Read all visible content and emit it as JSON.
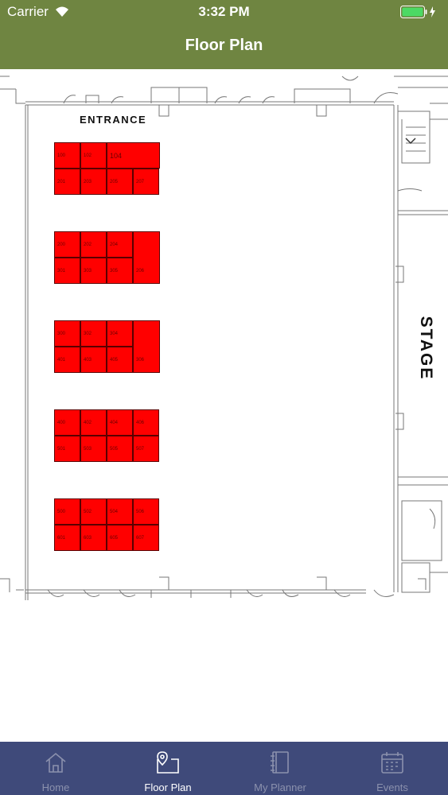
{
  "status": {
    "carrier": "Carrier",
    "time": "3:32 PM"
  },
  "header": {
    "title": "Floor Plan"
  },
  "map": {
    "entrance_label": "ENTRANCE",
    "stage_label": "STAGE",
    "booth_color": "#ff0000",
    "blocks": [
      {
        "top": [
          "100",
          "102",
          "104"
        ],
        "bottom": [
          "201",
          "203",
          "205",
          "207"
        ]
      },
      {
        "top": [
          "200",
          "202",
          "204"
        ],
        "bottom": [
          "301",
          "303",
          "305"
        ],
        "tall": "206"
      },
      {
        "top": [
          "300",
          "302",
          "304"
        ],
        "bottom": [
          "401",
          "403",
          "405"
        ],
        "tall": "306"
      },
      {
        "top": [
          "400",
          "402",
          "404",
          "406"
        ],
        "bottom": [
          "501",
          "503",
          "505",
          "507"
        ]
      },
      {
        "top": [
          "500",
          "502",
          "504",
          "506"
        ],
        "bottom": [
          "601",
          "603",
          "605",
          "607"
        ]
      }
    ]
  },
  "tabs": [
    {
      "label": "Home",
      "icon": "house-icon",
      "active": false
    },
    {
      "label": "Floor Plan",
      "icon": "map-pin-icon",
      "active": true
    },
    {
      "label": "My Planner",
      "icon": "notebook-icon",
      "active": false
    },
    {
      "label": "Events",
      "icon": "calendar-icon",
      "active": false
    }
  ],
  "colors": {
    "header": "#6f8541",
    "tabbar": "#3f4a7a",
    "tab_inactive": "#8b91ad",
    "tab_active": "#ffffff"
  }
}
